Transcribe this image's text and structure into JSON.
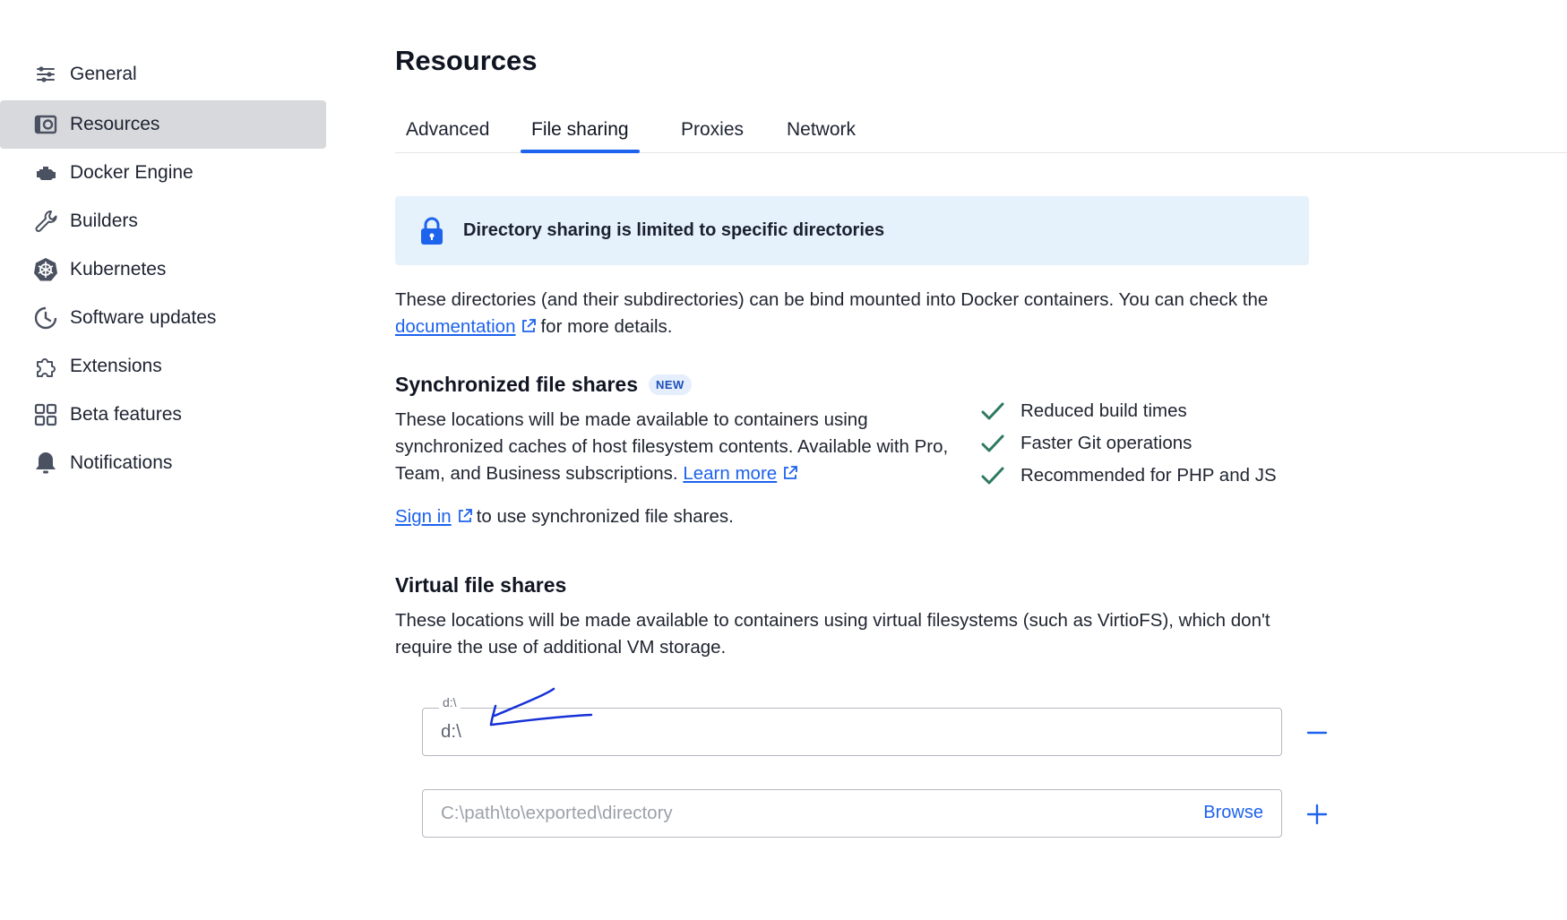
{
  "sidebar": {
    "items": [
      {
        "label": "General",
        "icon": "sliders-icon"
      },
      {
        "label": "Resources",
        "icon": "resources-icon",
        "active": true
      },
      {
        "label": "Docker Engine",
        "icon": "engine-icon"
      },
      {
        "label": "Builders",
        "icon": "wrench-icon"
      },
      {
        "label": "Kubernetes",
        "icon": "helm-wheel-icon"
      },
      {
        "label": "Software updates",
        "icon": "clock-update-icon"
      },
      {
        "label": "Extensions",
        "icon": "puzzle-icon"
      },
      {
        "label": "Beta features",
        "icon": "grid-icon"
      },
      {
        "label": "Notifications",
        "icon": "bell-icon"
      }
    ]
  },
  "main": {
    "title": "Resources",
    "tabs": [
      {
        "label": "Advanced"
      },
      {
        "label": "File sharing",
        "active": true
      },
      {
        "label": "Proxies"
      },
      {
        "label": "Network"
      }
    ],
    "banner": {
      "text": "Directory sharing is limited to specific directories",
      "icon": "lock-icon"
    },
    "intro": {
      "before": "These directories (and their subdirectories) can be bind mounted into Docker containers. You can check the",
      "link": "documentation",
      "after": "for more details."
    },
    "sync": {
      "title": "Synchronized file shares",
      "badge": "NEW",
      "description": "These locations will be made available to containers using synchronized caches of host filesystem contents. Available with Pro, Team, and Business subscriptions.",
      "learn_more": "Learn more",
      "sign_in": "Sign in",
      "sign_in_after": "to use synchronized file shares.",
      "features": [
        "Reduced build times",
        "Faster Git operations",
        "Recommended for PHP and JS"
      ]
    },
    "virtual": {
      "title": "Virtual file shares",
      "description": "These locations will be made available to containers using virtual filesystems (such as VirtioFS), which don't require the use of additional VM storage.",
      "existing_label": "d:\\",
      "existing_value": "d:\\",
      "new_placeholder": "C:\\path\\to\\exported\\directory",
      "browse": "Browse"
    }
  },
  "colors": {
    "accent": "#1d63ed",
    "check": "#2d7a5f",
    "banner_bg": "#e5f1fb"
  }
}
